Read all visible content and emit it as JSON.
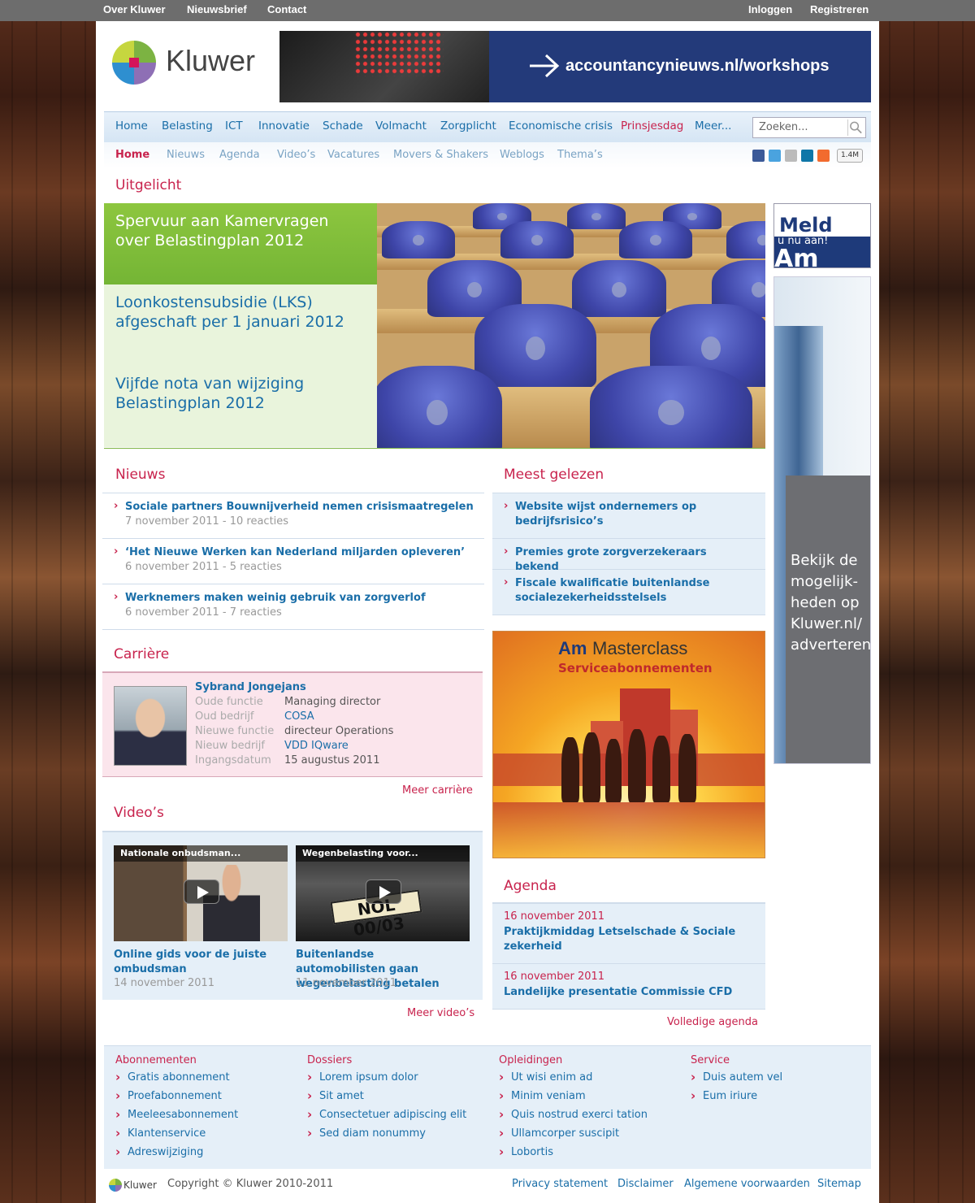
{
  "topbar": {
    "left": [
      "Over Kluwer",
      "Nieuwsbrief",
      "Contact"
    ],
    "right": [
      "Inloggen",
      "Registreren"
    ]
  },
  "logo": {
    "text": "Kluwer",
    "tm": "TM"
  },
  "banner": {
    "text": "accountancynieuws.nl/workshops"
  },
  "nav": {
    "items": [
      "Home",
      "Belasting",
      "ICT",
      "Innovatie",
      "Schade",
      "Volmacht",
      "Zorgplicht",
      "Economische crisis",
      "Prinsjesdag",
      "Meer..."
    ],
    "search_placeholder": "Zoeken..."
  },
  "subnav": {
    "items": [
      "Home",
      "Nieuws",
      "Agenda",
      "Video’s",
      "Vacatures",
      "Movers & Shakers",
      "Weblogs",
      "Thema’s"
    ],
    "share_count": "1.4M"
  },
  "uitgelicht": {
    "heading": "Uitgelicht",
    "items": [
      "Spervuur aan Kamervragen over Belastingplan 2012",
      "Loonkostensubsidie (LKS) afgeschaft per 1 januari 2012",
      "Vijfde nota van wijziging Belastingplan 2012"
    ]
  },
  "ad_meld": {
    "line1": "Meld",
    "line2": "u nu aan!",
    "line3": "Am"
  },
  "ad_sky": {
    "text": "Bekijk de mogelijk-heden op Kluwer.nl/ adverteren"
  },
  "nieuws": {
    "heading": "Nieuws",
    "items": [
      {
        "title": "Sociale partners Bouwnijverheid nemen crisismaatregelen",
        "meta": "7 november 2011 - 10 reacties"
      },
      {
        "title": "‘Het Nieuwe Werken kan Nederland miljarden opleveren’",
        "meta": "6 november 2011 - 5 reacties"
      },
      {
        "title": "Werknemers maken weinig gebruik van zorgverlof",
        "meta": "6 november 2011 - 7 reacties"
      }
    ]
  },
  "meest": {
    "heading": "Meest gelezen",
    "items": [
      "Website wijst ondernemers op bedrijfsrisico’s",
      "Premies grote zorgverzekeraars bekend",
      "Fiscale kwalificatie buitenlandse socialezekerheidsstelsels"
    ]
  },
  "carriere": {
    "heading": "Carrière",
    "name": "Sybrand Jongejans",
    "labels": [
      "Oude functie",
      "Oud bedrijf",
      "Nieuwe functie",
      "Nieuw bedrijf",
      "Ingangsdatum"
    ],
    "values": [
      "Managing director",
      "COSA",
      "directeur Operations",
      "VDD IQware",
      "15 augustus 2011"
    ],
    "more": "Meer carrière"
  },
  "videos": {
    "heading": "Video’s",
    "items": [
      {
        "caption": "Nationale onbudsman...",
        "title": "Online gids voor de juiste ombudsman",
        "date": "14 november 2011"
      },
      {
        "caption": "Wegenbelasting voor...",
        "title": "Buitenlandse automobilisten gaan wegenbelasting betalen",
        "date": "11 november 2011",
        "plate": "NOL 00/03"
      }
    ],
    "more": "Meer video’s"
  },
  "ad_master": {
    "brand": "Am",
    "title": "Masterclass",
    "subtitle": "Serviceabonnementen"
  },
  "agenda": {
    "heading": "Agenda",
    "items": [
      {
        "date": "16 november 2011",
        "title": "Praktijkmiddag Letselschade & Sociale zekerheid"
      },
      {
        "date": "16 november 2011",
        "title": "Landelijke presentatie Commissie CFD"
      }
    ],
    "more": "Volledige agenda"
  },
  "footer": {
    "cols": [
      {
        "heading": "Abonnementen",
        "links": [
          "Gratis abonnement",
          "Proefabonnement",
          "Meeleesabonnement",
          "Klantenservice",
          "Adreswijziging"
        ]
      },
      {
        "heading": "Dossiers",
        "links": [
          "Lorem ipsum dolor",
          "Sit amet",
          "Consectetuer adipiscing elit",
          "Sed diam nonummy"
        ]
      },
      {
        "heading": "Opleidingen",
        "links": [
          "Ut wisi enim ad",
          "Minim veniam",
          "Quis nostrud exerci tation",
          "Ullamcorper suscipit",
          "Lobortis"
        ]
      },
      {
        "heading": "Service",
        "links": [
          "Duis autem vel",
          "Eum iriure"
        ]
      }
    ]
  },
  "bottom": {
    "logo": "Kluwer",
    "copyright": "Copyright © Kluwer 2010-2011",
    "links": [
      "Privacy statement",
      "Disclaimer",
      "Algemene voorwaarden",
      "Sitemap"
    ]
  },
  "colors": {
    "accent": "#c8234d",
    "link": "#1a6ea8",
    "green": "#8dc63f",
    "lightblue": "#e5eff8"
  }
}
